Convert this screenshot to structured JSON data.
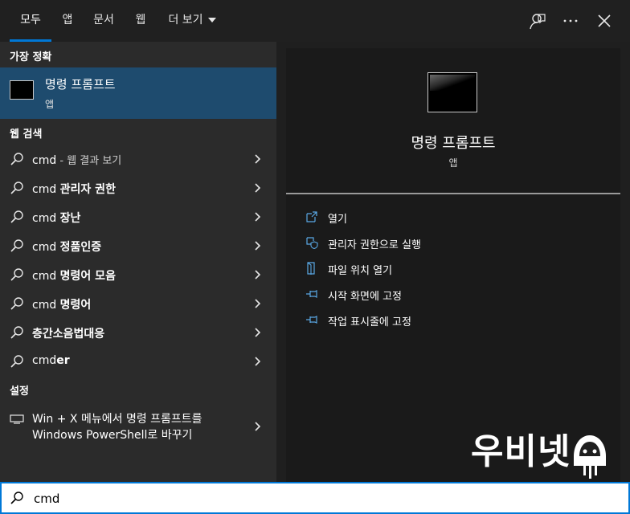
{
  "tabs": [
    {
      "label": "모두",
      "active": true
    },
    {
      "label": "앱",
      "active": false
    },
    {
      "label": "문서",
      "active": false
    },
    {
      "label": "웹",
      "active": false
    },
    {
      "label": "더 보기",
      "active": false
    }
  ],
  "top_icons": [
    "feedback-icon",
    "more-options-icon",
    "close-icon"
  ],
  "sections": {
    "best_match": "가장 정확",
    "web_search": "웹 검색",
    "settings": "설정"
  },
  "best_match": {
    "name": "명령 프롬프트",
    "type": "앱"
  },
  "web_results": [
    {
      "prefix": "cmd",
      "bold": "",
      "suffix": " - 웹 결과 보기"
    },
    {
      "prefix": "cmd ",
      "bold": "관리자 권한",
      "suffix": ""
    },
    {
      "prefix": "cmd ",
      "bold": "장난",
      "suffix": ""
    },
    {
      "prefix": "cmd ",
      "bold": "정품인증",
      "suffix": ""
    },
    {
      "prefix": "cmd ",
      "bold": "명령어 모음",
      "suffix": ""
    },
    {
      "prefix": "cmd ",
      "bold": "명령어",
      "suffix": ""
    },
    {
      "prefix": "",
      "bold": "층간소음법대응",
      "suffix": ""
    },
    {
      "prefix": "cmd",
      "bold": "er",
      "suffix": ""
    }
  ],
  "settings_item": {
    "line1": "Win + X 메뉴에서 명령 프롬프트를",
    "line2": "Windows PowerShell로 바꾸기"
  },
  "preview": {
    "name": "명령 프롬프트",
    "type": "앱"
  },
  "actions": [
    {
      "label": "열기",
      "icon": "open-icon"
    },
    {
      "label": "관리자 권한으로 실행",
      "icon": "shield-icon"
    },
    {
      "label": "파일 위치 열기",
      "icon": "file-location-icon"
    },
    {
      "label": "시작 화면에 고정",
      "icon": "pin-icon"
    },
    {
      "label": "작업 표시줄에 고정",
      "icon": "pin-icon"
    }
  ],
  "watermark": {
    "text": "우비넷"
  },
  "search": {
    "value": "cmd"
  },
  "colors": {
    "accent": "#0078d7",
    "selected": "#1e4b6e"
  }
}
